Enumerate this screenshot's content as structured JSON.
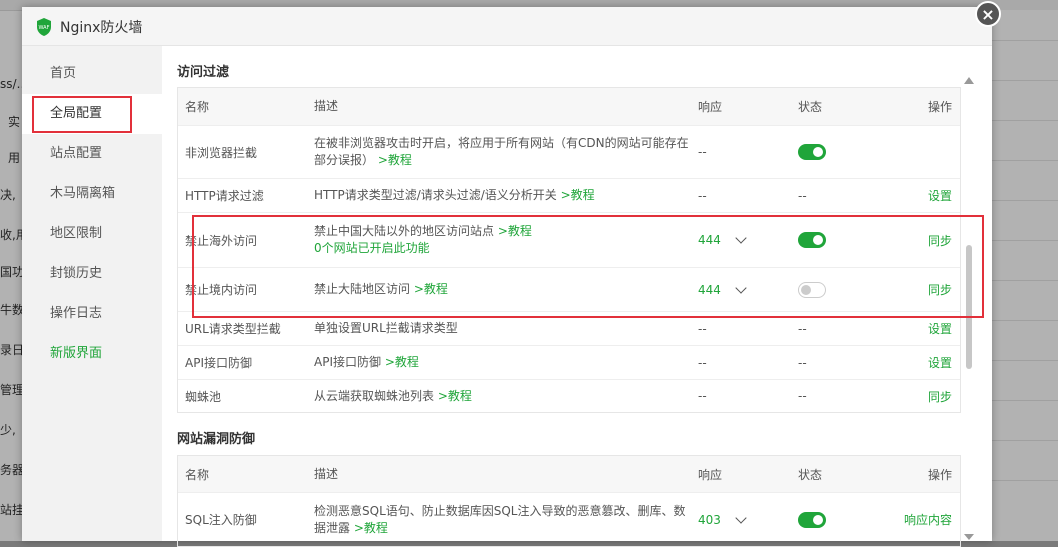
{
  "background": {
    "rows": [
      "ss/…",
      "实",
      "用",
      "决,",
      "收,用",
      "国功",
      "牛数的",
      "录日",
      "管理",
      "少,",
      "务器",
      "站挂"
    ]
  },
  "modal": {
    "title": "Nginx防火墙",
    "logo_text": "WAF",
    "close": "×"
  },
  "sidebar": {
    "items": [
      {
        "label": "首页"
      },
      {
        "label": "全局配置"
      },
      {
        "label": "站点配置"
      },
      {
        "label": "木马隔离箱"
      },
      {
        "label": "地区限制"
      },
      {
        "label": "封锁历史"
      },
      {
        "label": "操作日志"
      },
      {
        "label": "新版界面"
      }
    ]
  },
  "section1": {
    "title": "访问过滤",
    "headers": {
      "name": "名称",
      "desc": "描述",
      "resp": "响应",
      "stat": "状态",
      "op": "操作"
    },
    "rows": [
      {
        "name": "非浏览器拦截",
        "desc": "在被非浏览器攻击时开启，将应用于所有网站（有CDN的网站可能存在部分误报）",
        "link": ">教程",
        "extra": "",
        "resp": "--",
        "stat": "on",
        "op": ""
      },
      {
        "name": "HTTP请求过滤",
        "desc": "HTTP请求类型过滤/请求头过滤/语义分析开关",
        "link": ">教程",
        "extra": "",
        "resp": "--",
        "stat": "--",
        "op": "设置"
      },
      {
        "name": "禁止海外访问",
        "desc": "禁止中国大陆以外的地区访问站点",
        "link": ">教程",
        "extra": "0个网站已开启此功能",
        "resp": "444",
        "stat": "on",
        "op": "同步"
      },
      {
        "name": "禁止境内访问",
        "desc": "禁止大陆地区访问",
        "link": ">教程",
        "extra": "",
        "resp": "444",
        "stat": "off",
        "op": "同步"
      },
      {
        "name": "URL请求类型拦截",
        "desc": "单独设置URL拦截请求类型",
        "link": "",
        "extra": "",
        "resp": "--",
        "stat": "--",
        "op": "设置"
      },
      {
        "name": "API接口防御",
        "desc": "API接口防御",
        "link": ">教程",
        "extra": "",
        "resp": "--",
        "stat": "--",
        "op": "设置"
      },
      {
        "name": "蜘蛛池",
        "desc": "从云端获取蜘蛛池列表",
        "link": ">教程",
        "extra": "",
        "resp": "--",
        "stat": "--",
        "op": "同步"
      }
    ]
  },
  "section2": {
    "title": "网站漏洞防御",
    "headers": {
      "name": "名称",
      "desc": "描述",
      "resp": "响应",
      "stat": "状态",
      "op": "操作"
    },
    "rows": [
      {
        "name": "SQL注入防御",
        "desc": "检测恶意SQL语句、防止数据库因SQL注入导致的恶意篡改、删库、数据泄露",
        "link": ">教程",
        "resp": "403",
        "stat": "on",
        "op": "响应内容"
      }
    ]
  },
  "colors": {
    "accent": "#20a53a",
    "highlight": "#e2303a"
  }
}
